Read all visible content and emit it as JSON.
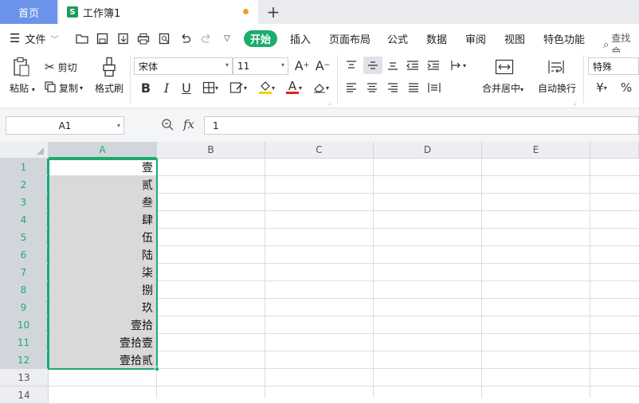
{
  "tabs": {
    "home": "首页",
    "document": "工作簿1",
    "doc_icon_letter": "S"
  },
  "menu": {
    "file": "文件",
    "items": [
      "开始",
      "插入",
      "页面布局",
      "公式",
      "数据",
      "审阅",
      "视图",
      "特色功能"
    ],
    "search": "查找命"
  },
  "ribbon": {
    "paste": "粘贴",
    "cut": "剪切",
    "copy": "复制",
    "format_painter": "格式刷",
    "font_name": "宋体",
    "font_size": "11",
    "merge_center": "合并居中",
    "wrap_text": "自动换行",
    "number_format": "特殊",
    "currency_symbol": "¥",
    "percent_symbol": "%",
    "bold": "B",
    "italic": "I",
    "underline": "U",
    "font_color_letter": "A",
    "grow_font_letter": "A",
    "shrink_font_letter": "A",
    "font_color": "#e02020",
    "fill_color": "#f5d000"
  },
  "formula_bar": {
    "name_box": "A1",
    "fx": "fx",
    "value": "1"
  },
  "sheet": {
    "columns": [
      "A",
      "B",
      "C",
      "D",
      "E"
    ],
    "rows": [
      "1",
      "2",
      "3",
      "4",
      "5",
      "6",
      "7",
      "8",
      "9",
      "10",
      "11",
      "12",
      "13",
      "14"
    ],
    "column_a": [
      "壹",
      "贰",
      "叁",
      "肆",
      "伍",
      "陆",
      "柒",
      "捌",
      "玖",
      "壹拾",
      "壹拾壹",
      "壹拾贰"
    ],
    "selected_range": "A1:A12",
    "accent": "#1aad6c"
  }
}
